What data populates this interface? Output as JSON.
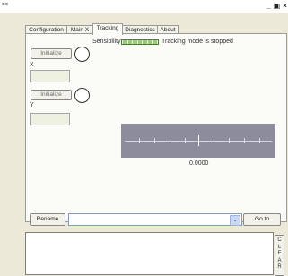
{
  "window": {
    "title": "ᴑᴑ",
    "controls": [
      "_",
      "▣",
      "×"
    ]
  },
  "tabs": [
    {
      "label": "Configuration",
      "active": false
    },
    {
      "label": "Main X",
      "active": false
    },
    {
      "label": "Tracking",
      "active": true
    },
    {
      "label": "Diagnostics",
      "active": false
    },
    {
      "label": "About",
      "active": false
    }
  ],
  "tracking": {
    "sensibility_label": "Sensibility",
    "status_text": "Tracking mode is stopped",
    "x": {
      "initialize_label": "Initialize",
      "axis_label": "X",
      "value": ""
    },
    "y": {
      "initialize_label": "Initialize",
      "axis_label": "Y",
      "value": ""
    },
    "slider_value": "0.0000"
  },
  "bottom": {
    "rename_label": "Rename",
    "selection": "",
    "dropdown_arrow": "⌄",
    "goto_label": "Go to",
    "clear_letters": [
      "C",
      "L",
      "E",
      "A",
      "R"
    ]
  },
  "colors": {
    "window_bg": "#ece9d8",
    "panel_bg": "#fbfbf7",
    "sensibility_fill": "#9cc87a",
    "slider_bg": "#8c8c9c"
  }
}
